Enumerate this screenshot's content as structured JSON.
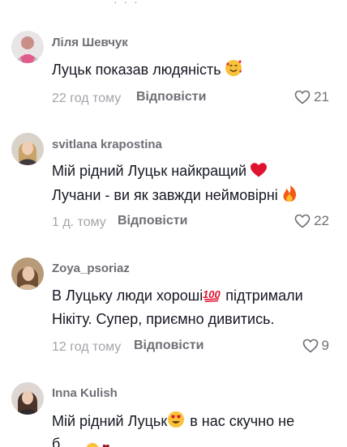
{
  "comments": [
    {
      "username": "Ліля Шевчук",
      "lines": [
        "Луцьк показав людяність"
      ],
      "time": "22 год тому",
      "reply_label": "Відповісти",
      "likes": "21"
    },
    {
      "username": "svitlana krapostina",
      "lines": [
        "Мій рідний Луцьк найкращий",
        "Лучани - ви як завжди неймовірні"
      ],
      "time": "1 д. тому",
      "reply_label": "Відповісти",
      "likes": "22"
    },
    {
      "username": "Zoya_psoriaz",
      "lines": [
        "В Луцьку люди хороші",
        "підтримали",
        "Нікіту. Супер, приємно дивитись."
      ],
      "time": "12 год тому",
      "reply_label": "Відповісти",
      "likes": "9"
    },
    {
      "username": "Inna Kulish",
      "lines": [
        "Мій рідний Луцьк",
        "в нас скучно не"
      ],
      "time": "",
      "reply_label": "",
      "likes": ""
    }
  ],
  "emoji_names": [
    "smiling-face-with-hearts",
    "red-heart",
    "fire",
    "hundred-points",
    "heart-eyes"
  ],
  "colors": {
    "text": "#161823",
    "username": "#6e6f76",
    "meta": "#a3a4aa"
  }
}
